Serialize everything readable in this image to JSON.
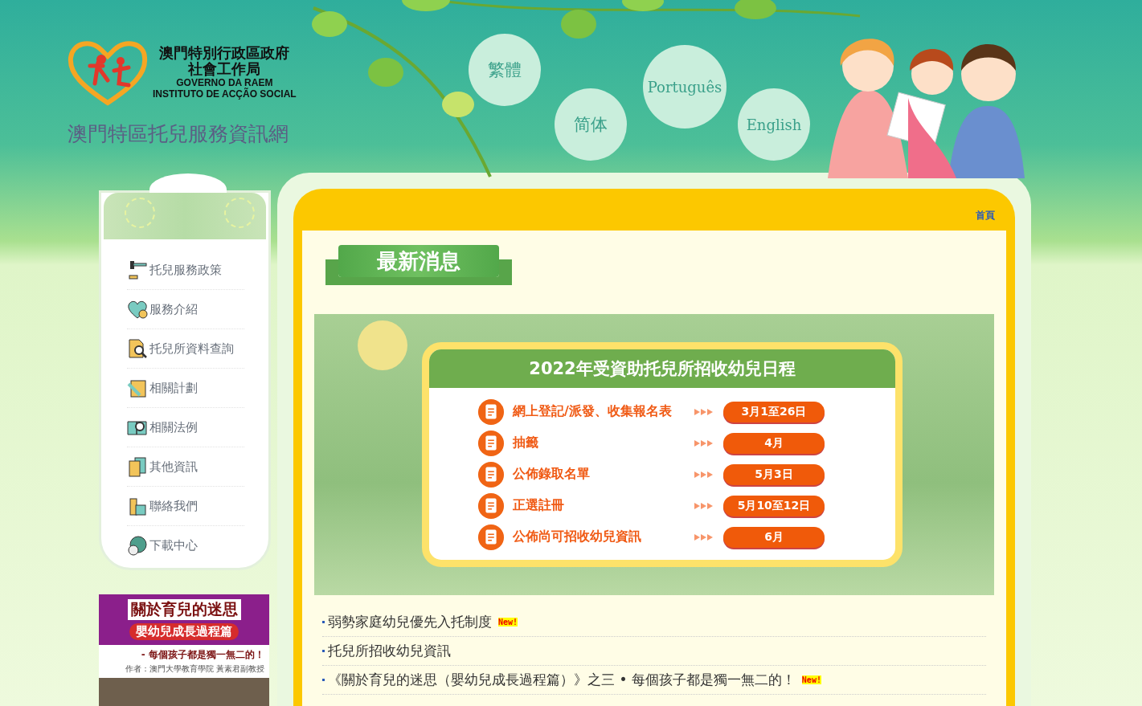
{
  "header": {
    "org_zh_line1": "澳門特別行政區政府",
    "org_zh_line2": "社會工作局",
    "org_pt_line1": "GOVERNO DA RAEM",
    "org_pt_line2": "INSTITUTO DE ACÇÃO SOCIAL",
    "site_title": "澳門特區托兒服務資訊網",
    "languages": [
      "繁體",
      "简体",
      "Português",
      "English"
    ]
  },
  "sidebar": {
    "items": [
      {
        "label": "托兒服務政策"
      },
      {
        "label": "服務介紹"
      },
      {
        "label": "托兒所資料查詢"
      },
      {
        "label": "相關計劃"
      },
      {
        "label": "相關法例"
      },
      {
        "label": "其他資訊"
      },
      {
        "label": "聯絡我們"
      },
      {
        "label": "下載中心"
      }
    ]
  },
  "promo": {
    "title": "關於育兒的迷思",
    "subtitle": "嬰幼兒成長過程篇",
    "tagline": "- 每個孩子都是獨一無二的！",
    "author": "作者：澳門大學教育學院 黃素君副教授"
  },
  "breadcrumb": "首頁",
  "section_title": "最新消息",
  "schedule": {
    "title": "2022年受資助托兒所招收幼兒日程",
    "steps": [
      {
        "label": "網上登記/派發、收集報名表",
        "date": "3月1至26日"
      },
      {
        "label": "抽籤",
        "date": "4月"
      },
      {
        "label": "公佈錄取名單",
        "date": "5月3日"
      },
      {
        "label": "正選註冊",
        "date": "5月10至12日"
      },
      {
        "label": "公佈尚可招收幼兒資訊",
        "date": "6月"
      }
    ]
  },
  "news": [
    {
      "title": "弱勢家庭幼兒優先入托制度",
      "badge": "New!"
    },
    {
      "title": "托兒所招收幼兒資訊"
    },
    {
      "title": "《關於育兒的迷思（嬰幼兒成長過程篇）》之三 • 每個孩子都是獨一無二的！",
      "badge": "New!"
    }
  ]
}
